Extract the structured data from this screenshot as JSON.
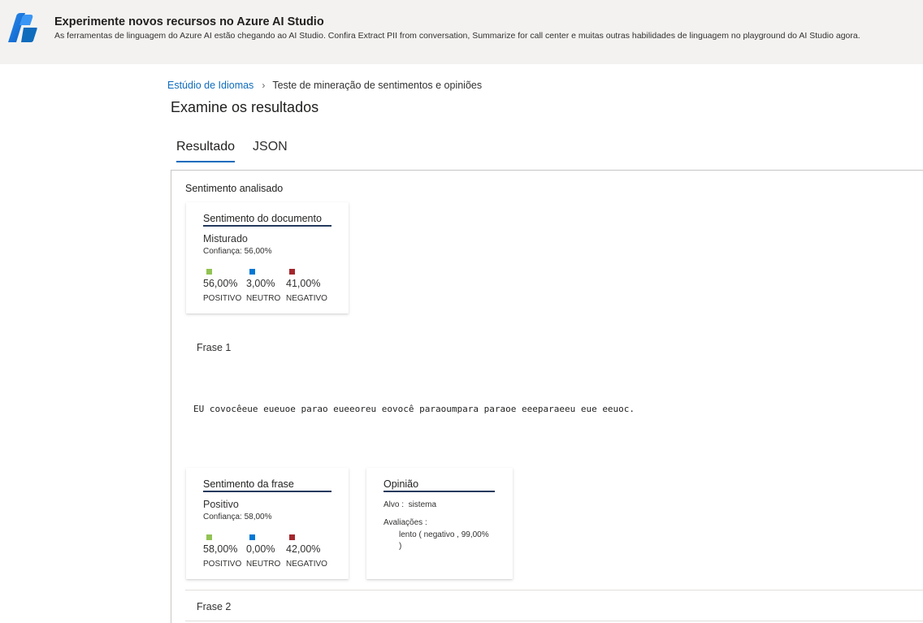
{
  "banner": {
    "title": "Experimente novos recursos no Azure AI Studio",
    "description": "As ferramentas de linguagem do Azure AI estão chegando ao AI Studio. Confira Extract PII from conversation, Summarize for call center e muitas outras habilidades de linguagem no playground do AI Studio agora.",
    "logo_icon": "azure-ai-studio-logo",
    "accent": "#0f6cbd"
  },
  "breadcrumb": {
    "root": "Estúdio de Idiomas",
    "separator_icon": "chevron-right-icon",
    "current": "Teste de mineração de sentimentos e opiniões"
  },
  "page_title": "Examine os resultados",
  "tabs": [
    {
      "label": "Resultado",
      "active": true
    },
    {
      "label": "JSON",
      "active": false
    }
  ],
  "section_label": "Sentimento analisado",
  "colors": {
    "positive": "#92c353",
    "neutral": "#0078d4",
    "negative": "#a4262c"
  },
  "document_card": {
    "title": "Sentimento do documento",
    "value": "Misturado",
    "confidence": "Confiança: 56,00%",
    "stats": [
      {
        "pct": "56,00%",
        "label": "POSITIVO"
      },
      {
        "pct": "3,00%",
        "label": "NEUTRO"
      },
      {
        "pct": "41,00%",
        "label": "NEGATIVO"
      }
    ]
  },
  "frase1": {
    "label": "Frase 1",
    "text": "EU covocêeue eueuoe parao eueeoreu eovocê paraoumpara paraoe eeeparaeeu eue eeuoc."
  },
  "sentence_card": {
    "title": "Sentimento da frase",
    "value": "Positivo",
    "confidence": "Confiança: 58,00%",
    "stats": [
      {
        "pct": "58,00%",
        "label": "POSITIVO"
      },
      {
        "pct": "0,00%",
        "label": "NEUTRO"
      },
      {
        "pct": "42,00%",
        "label": "NEGATIVO"
      }
    ]
  },
  "opinion_card": {
    "title": "Opinião",
    "target_label": "Alvo :",
    "target_value": "sistema",
    "assessments_label": "Avaliações :",
    "assessment_line1": "lento ( negativo , 99,00%",
    "assessment_line2": ")"
  },
  "frase2": {
    "label": "Frase 2"
  }
}
